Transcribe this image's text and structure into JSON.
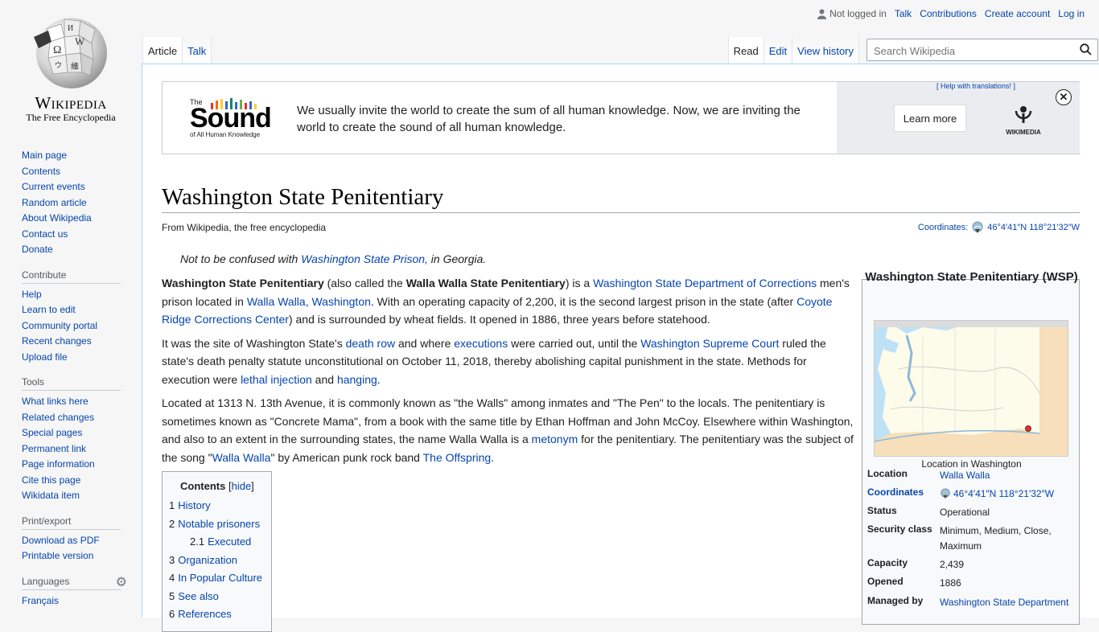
{
  "logo": {
    "wordmark": "Wikipedia",
    "tagline": "The Free Encyclopedia"
  },
  "personal": {
    "not_logged_in": "Not logged in",
    "talk": "Talk",
    "contributions": "Contributions",
    "create_account": "Create account",
    "log_in": "Log in"
  },
  "tabs": {
    "article": "Article",
    "talk": "Talk",
    "read": "Read",
    "edit": "Edit",
    "view_history": "View history"
  },
  "search": {
    "placeholder": "Search Wikipedia"
  },
  "sidebar": {
    "nav": [
      "Main page",
      "Contents",
      "Current events",
      "Random article",
      "About Wikipedia",
      "Contact us",
      "Donate"
    ],
    "contribute_heading": "Contribute",
    "contribute": [
      "Help",
      "Learn to edit",
      "Community portal",
      "Recent changes",
      "Upload file"
    ],
    "tools_heading": "Tools",
    "tools": [
      "What links here",
      "Related changes",
      "Special pages",
      "Permanent link",
      "Page information",
      "Cite this page",
      "Wikidata item"
    ],
    "print_heading": "Print/export",
    "print": [
      "Download as PDF",
      "Printable version"
    ],
    "languages_heading": "Languages",
    "languages": [
      "Français"
    ]
  },
  "banner": {
    "logo_the": "The",
    "logo_word": "Sound",
    "logo_sub": "of All Human Knowledge",
    "text": "We usually invite the world to create the sum of all human knowledge. Now, we are inviting the world to create the sound of all human knowledge.",
    "help": "[ Help with translations! ]",
    "learn_more": "Learn more",
    "close": "✕",
    "wmf": "WIKIMEDIA"
  },
  "article": {
    "title": "Washington State Penitentiary",
    "from": "From Wikipedia, the free encyclopedia",
    "coords_label": "Coordinates:",
    "coords": "46°4′41″N 118°21′32″W",
    "hatnote_pre": "Not to be confused with ",
    "hatnote_link": "Washington State Prison,",
    "hatnote_post": " in Georgia.",
    "p1": {
      "b1": "Washington State Penitentiary",
      "t1": " (also called the ",
      "b2": "Walla Walla State Penitentiary",
      "t2": ") is a ",
      "l1": "Washington State Department of Corrections",
      "t3": " men's prison located in ",
      "l2": "Walla Walla, Washington",
      "t4": ". With an operating capacity of 2,200, it is the second largest prison in the state (after ",
      "l3": "Coyote Ridge Corrections Center",
      "t5": ") and is surrounded by wheat fields. It opened in 1886, three years before statehood."
    },
    "p2": {
      "t1": "It was the site of Washington State's ",
      "l1": "death row",
      "t2": " and where ",
      "l2": "executions",
      "t3": " were carried out, until the ",
      "l3": "Washington Supreme Court",
      "t4": " ruled the state's death penalty statute unconstitutional on October 11, 2018, thereby abolishing capital punishment in the state. Methods for execution were ",
      "l4": "lethal injection",
      "t5": " and ",
      "l5": "hanging",
      "t6": "."
    },
    "p3": {
      "t1": "Located at 1313 N. 13th Avenue, it is commonly known as \"the Walls\" among inmates and \"The Pen\" to the locals. The penitentiary is sometimes known as \"Concrete Mama\", from a book with the same title by Ethan Hoffman and John McCoy. Elsewhere within Washington, and also to an extent in the surrounding states, the name Walla Walla is a ",
      "l1": "metonym",
      "t2": " for the penitentiary. The penitentiary was the subject of the song \"",
      "l2": "Walla Walla",
      "t3": "\" by American punk rock band ",
      "l3": "The Offspring",
      "t4": "."
    }
  },
  "toc": {
    "title": "Contents",
    "hide": "hide",
    "items": [
      {
        "num": "1",
        "label": "History"
      },
      {
        "num": "2",
        "label": "Notable prisoners"
      },
      {
        "num": "2.1",
        "label": "Executed"
      },
      {
        "num": "3",
        "label": "Organization"
      },
      {
        "num": "4",
        "label": "In Popular Culture"
      },
      {
        "num": "5",
        "label": "See also"
      },
      {
        "num": "6",
        "label": "References"
      }
    ]
  },
  "infobox": {
    "title": "Washington State Penitentiary (WSP)",
    "caption": "Location in Washington",
    "rows": [
      {
        "label": "Location",
        "value": "Walla Walla"
      },
      {
        "label": "Coordinates",
        "value": "46°4′41″N 118°21′32″W"
      },
      {
        "label": "Status",
        "value": "Operational"
      },
      {
        "label": "Security class",
        "value": "Minimum, Medium, Close, Maximum"
      },
      {
        "label": "Capacity",
        "value": "2,439"
      },
      {
        "label": "Opened",
        "value": "1886"
      },
      {
        "label": "Managed by",
        "value": "Washington State Department"
      }
    ]
  }
}
